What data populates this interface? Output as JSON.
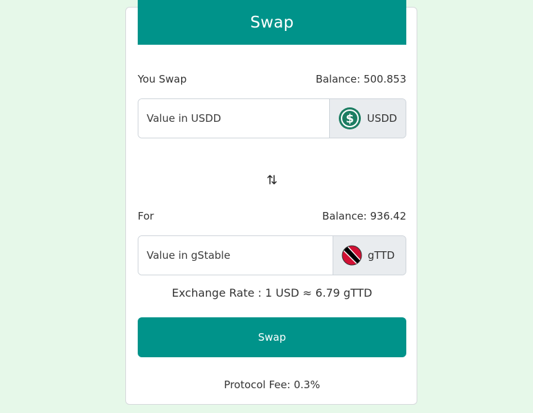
{
  "header": {
    "title": "Swap"
  },
  "from": {
    "label": "You Swap",
    "balance": "Balance: 500.853",
    "placeholder": "Value in USDD",
    "token": "USDD",
    "token_icon": "usdd-coin-icon"
  },
  "switch_icon": "swap-arrows-icon",
  "to": {
    "label": "For",
    "balance": "Balance: 936.42",
    "placeholder": "Value in gStable",
    "token": "gTTD",
    "token_icon": "trinidad-flag-icon"
  },
  "exchange_rate": "Exchange Rate : 1 USD ≈ 6.79 gTTD",
  "swap_button": "Swap",
  "protocol_fee": "Protocol Fee: 0.3%",
  "colors": {
    "primary": "#00938a",
    "background": "#e6f8e9",
    "addon_bg": "#e9ecef"
  }
}
